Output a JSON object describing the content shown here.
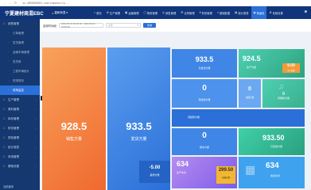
{
  "browser": {
    "url": "sz.4000083001.com/zhaohuo/tu..."
  },
  "app": {
    "logo": "宁夏建材商混EBC",
    "company": "嘉和商混"
  },
  "topnav": {
    "items": [
      {
        "label": "首页",
        "icon": "home-icon"
      },
      {
        "label": "生产管理",
        "icon": "factory-icon"
      },
      {
        "label": "运输管理",
        "icon": "truck-icon"
      },
      {
        "label": "物资管理",
        "icon": "box-icon"
      },
      {
        "label": "销售管理",
        "icon": "cart-icon"
      },
      {
        "label": "合同管理",
        "icon": "doc-icon"
      },
      {
        "label": "财务管理",
        "icon": "money-icon"
      },
      {
        "label": "基础数据",
        "icon": "database-icon"
      },
      {
        "label": "统计报表",
        "icon": "report-icon"
      },
      {
        "label": "商品砼",
        "icon": "mixer-icon"
      },
      {
        "label": "系统设置",
        "icon": "gear-icon"
      }
    ],
    "active_index": 9
  },
  "sidebar": {
    "items": [
      {
        "label": "销售管理",
        "sub": false,
        "chevron": true
      },
      {
        "label": "订单管理",
        "sub": true
      },
      {
        "label": "发货管理",
        "sub": true
      },
      {
        "label": "运输车辆管理",
        "sub": true
      },
      {
        "label": "发货单",
        "sub": true
      },
      {
        "label": "工程车辆统计",
        "sub": true
      },
      {
        "label": "现场签收",
        "sub": true
      },
      {
        "label": "现场监控",
        "sub": true,
        "active": true
      },
      {
        "label": "生产管理",
        "sub": false,
        "chevron": true
      },
      {
        "label": "原料管理",
        "sub": false,
        "chevron": true
      },
      {
        "label": "库存管理",
        "sub": false,
        "chevron": true
      },
      {
        "label": "财务管理",
        "sub": false,
        "chevron": true
      },
      {
        "label": "质检管理",
        "sub": false,
        "chevron": true
      },
      {
        "label": "统计报表",
        "sub": false,
        "chevron": true
      },
      {
        "label": "系统管理",
        "sub": false,
        "chevron": true
      },
      {
        "label": "基础设置",
        "sub": false,
        "chevron": true
      }
    ],
    "bottom_label": "当前版本",
    "tooltip": "现场监控"
  },
  "filter": {
    "date_label": "选择时间段",
    "date_value": "2020-05-01 00:00:00 - 2020-05-01 23:59:59",
    "select_placeholder": "全部",
    "query_label": "查询"
  },
  "tiles": {
    "sales": {
      "value": "928.5",
      "label": "销售方量"
    },
    "shipped_total": {
      "value": "933.5",
      "label": "发货方量"
    },
    "shipped": {
      "value": "933.5",
      "label": "已发货方量"
    },
    "produced": {
      "value": "924.5",
      "label": "生产方量"
    },
    "small_orange": {
      "value": "9.00",
      "label": "生产差量"
    },
    "check1": {
      "value": "0",
      "label": "待签收方量"
    },
    "check2": {
      "value": "0",
      "label": "退货方量"
    },
    "review": {
      "value": "0",
      "label": "待审核方量"
    },
    "wide": {
      "label": "待结算方量"
    },
    "load": {
      "value": "0",
      "label": "装车方量"
    },
    "green": {
      "value": "933.50",
      "label": "已签收方量"
    },
    "negative": {
      "value": "-5.00",
      "label": "差值方量"
    },
    "purple": {
      "value": "634",
      "label": "生产车次"
    },
    "yellow": {
      "value": "299.50",
      "label": "运输方量"
    },
    "waiting": {
      "value": "634",
      "label": "发货车次"
    }
  },
  "colors": {
    "nav": "#10357a",
    "sidebar": "#14386f",
    "accent": "#2b6fd8",
    "orange": "#f0692f",
    "green": "#2ea37f",
    "purple": "#7d5ce8",
    "yellow": "#f2b731"
  }
}
